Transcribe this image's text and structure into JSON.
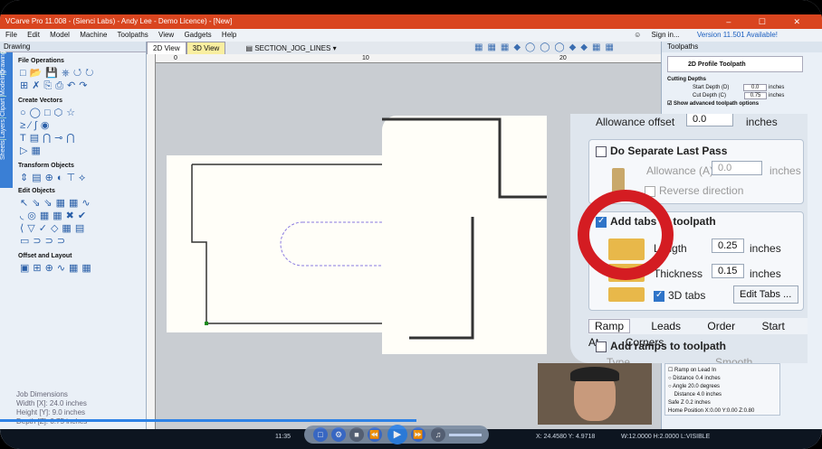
{
  "window": {
    "title": "VCarve Pro 11.008 - (Sienci Labs) - Andy Lee - Demo Licence) - [New]",
    "controls": "–  ☐  ✕"
  },
  "menu": {
    "items": [
      "File",
      "Edit",
      "Model",
      "Machine",
      "Toolpaths",
      "View",
      "Gadgets",
      "Help"
    ],
    "sign_in": "Sign in...",
    "version_notice": "Version 11.501 Available!"
  },
  "left_panel": {
    "title": "Drawing",
    "side_tabs": [
      "Drawing",
      "Modeling",
      "Clipart",
      "Layers",
      "Sheets"
    ],
    "sections": {
      "file_ops": "File Operations",
      "create_vectors": "Create Vectors",
      "transform": "Transform Objects",
      "edit_objects": "Edit Objects",
      "offset_layout": "Offset and Layout"
    },
    "job_dimensions": {
      "title": "Job Dimensions",
      "width": "Width  [X]: 24.0 inches",
      "height": "Height [Y]: 9.0 inches",
      "depth": "Depth  [Z]: 0.75 inches"
    }
  },
  "doc": {
    "tab_2d": "2D View",
    "tab_3d": "3D View",
    "layer": "SECTION_JOG_LINES",
    "ruler_labels": [
      "0",
      "10",
      "20"
    ]
  },
  "right_panel": {
    "title": "Toolpaths",
    "toolpath_title": "2D Profile Toolpath",
    "cutting_depths": "Cutting Depths",
    "start_depth_label": "Start Depth (D)",
    "start_depth": "0.0",
    "cut_depth_label": "Cut Depth (C)",
    "cut_depth": "0.75",
    "unit": "inches",
    "show_advanced": "Show advanced toolpath options",
    "small_panel": {
      "ramp_on_lead_in": "Ramp on Lead In",
      "distance_label": "Distance",
      "distance_value": "0.4",
      "angle_label": "Angle",
      "angle_value": "20.0",
      "angle_unit": "degrees",
      "distance2_label": "Distance",
      "distance2_value": "4.0",
      "safe_z": "Safe Z          0.2 inches",
      "home_position": "Home Position   X:0.00 Y:0.00 Z:0.80"
    }
  },
  "zoom_panel": {
    "allowance_offset_label": "Allowance offset",
    "allowance_offset_value": "0.0",
    "unit": "inches",
    "separate_last_pass": "Do Separate Last Pass",
    "allowance_a_label": "Allowance (A)",
    "allowance_a_value": "0.0",
    "reverse_direction": "Reverse direction",
    "add_tabs": "Add tabs to toolpath",
    "length_label": "Length",
    "length_value": "0.25",
    "thickness_label": "Thickness",
    "thickness_value": "0.15",
    "tabs_3d": "3D tabs",
    "edit_tabs": "Edit Tabs ...",
    "tabs": [
      "Ramp",
      "Leads",
      "Order",
      "Start At",
      "Corners"
    ],
    "add_ramps": "Add ramps to toolpath",
    "type_label": "Type",
    "smooth": "Smooth"
  },
  "status": {
    "time": "11:35",
    "coords": "X: 24.4580 Y: 4.9718",
    "dims": "W:12.0000  H:2.0000  L:VISIBLE"
  },
  "colors": {
    "accent": "#2d82e6",
    "highlight_ring": "#d41c22",
    "titlebar": "#d9451f"
  }
}
